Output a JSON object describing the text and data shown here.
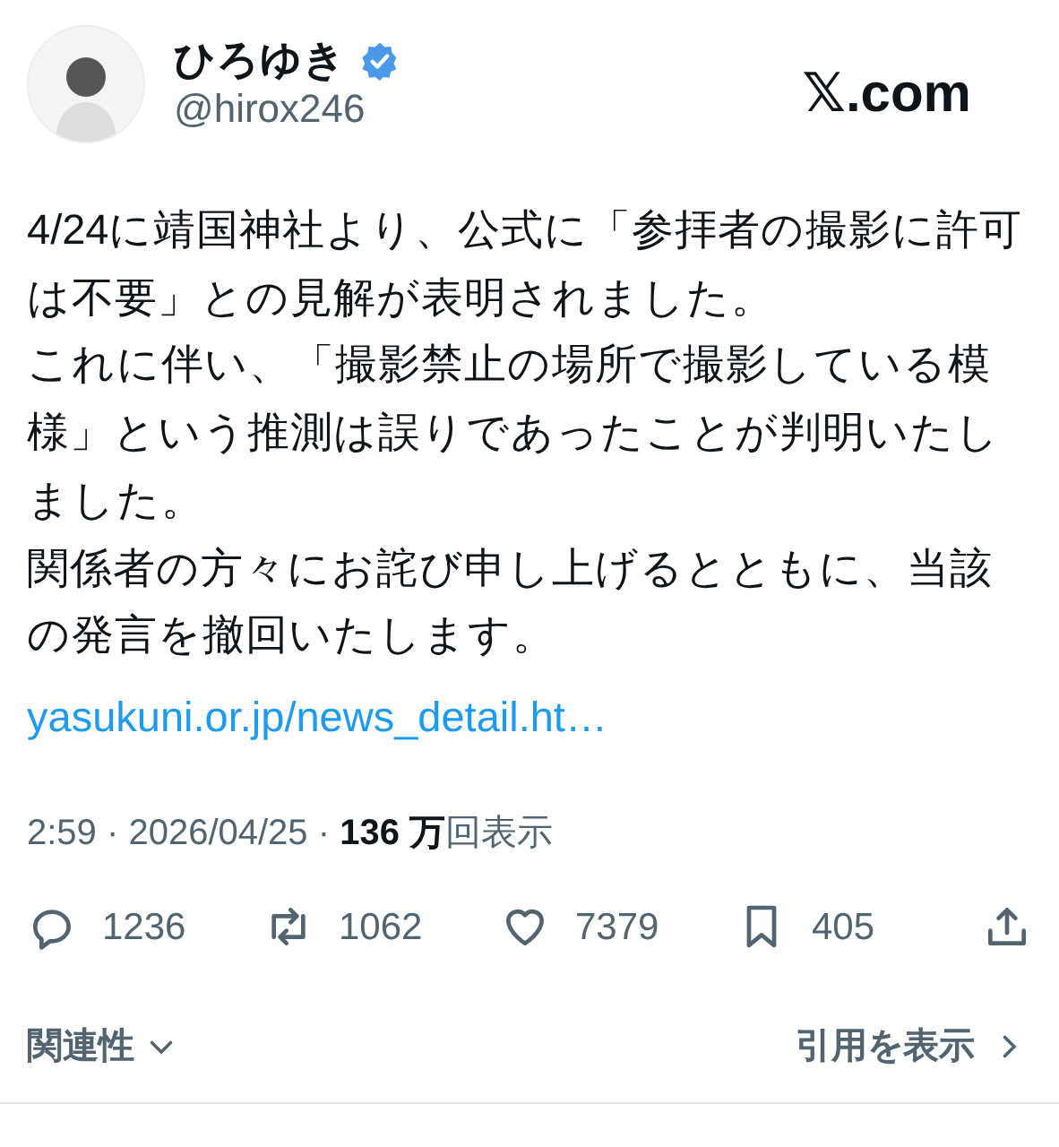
{
  "author": {
    "name": "ひろゆき",
    "verified": true,
    "handle": "@hirox246"
  },
  "brand": "𝕏.com",
  "paragraphs": [
    "4/24に靖国神社より、公式に「参拝者の撮影に許可は不要」との見解が表明されました。",
    "これに伴い、「撮影禁止の場所で撮影している模様」という推測は誤りであったことが判明いたしました。",
    "関係者の方々にお詫び申し上げるとともに、当該の発言を撤回いたします。"
  ],
  "link": "yasukuni.or.jp/news_detail.ht…",
  "meta": "2:59 · 2026/04/25 · **136 万**回表示",
  "actions": [
    {
      "kind": "reply",
      "count": "1236"
    },
    {
      "kind": "repost",
      "count": "1062"
    },
    {
      "kind": "like",
      "count": "7379"
    },
    {
      "kind": "bookmark",
      "count": "405"
    },
    {
      "kind": "share"
    }
  ],
  "sort": "関連性",
  "quotes": "引用を表示"
}
